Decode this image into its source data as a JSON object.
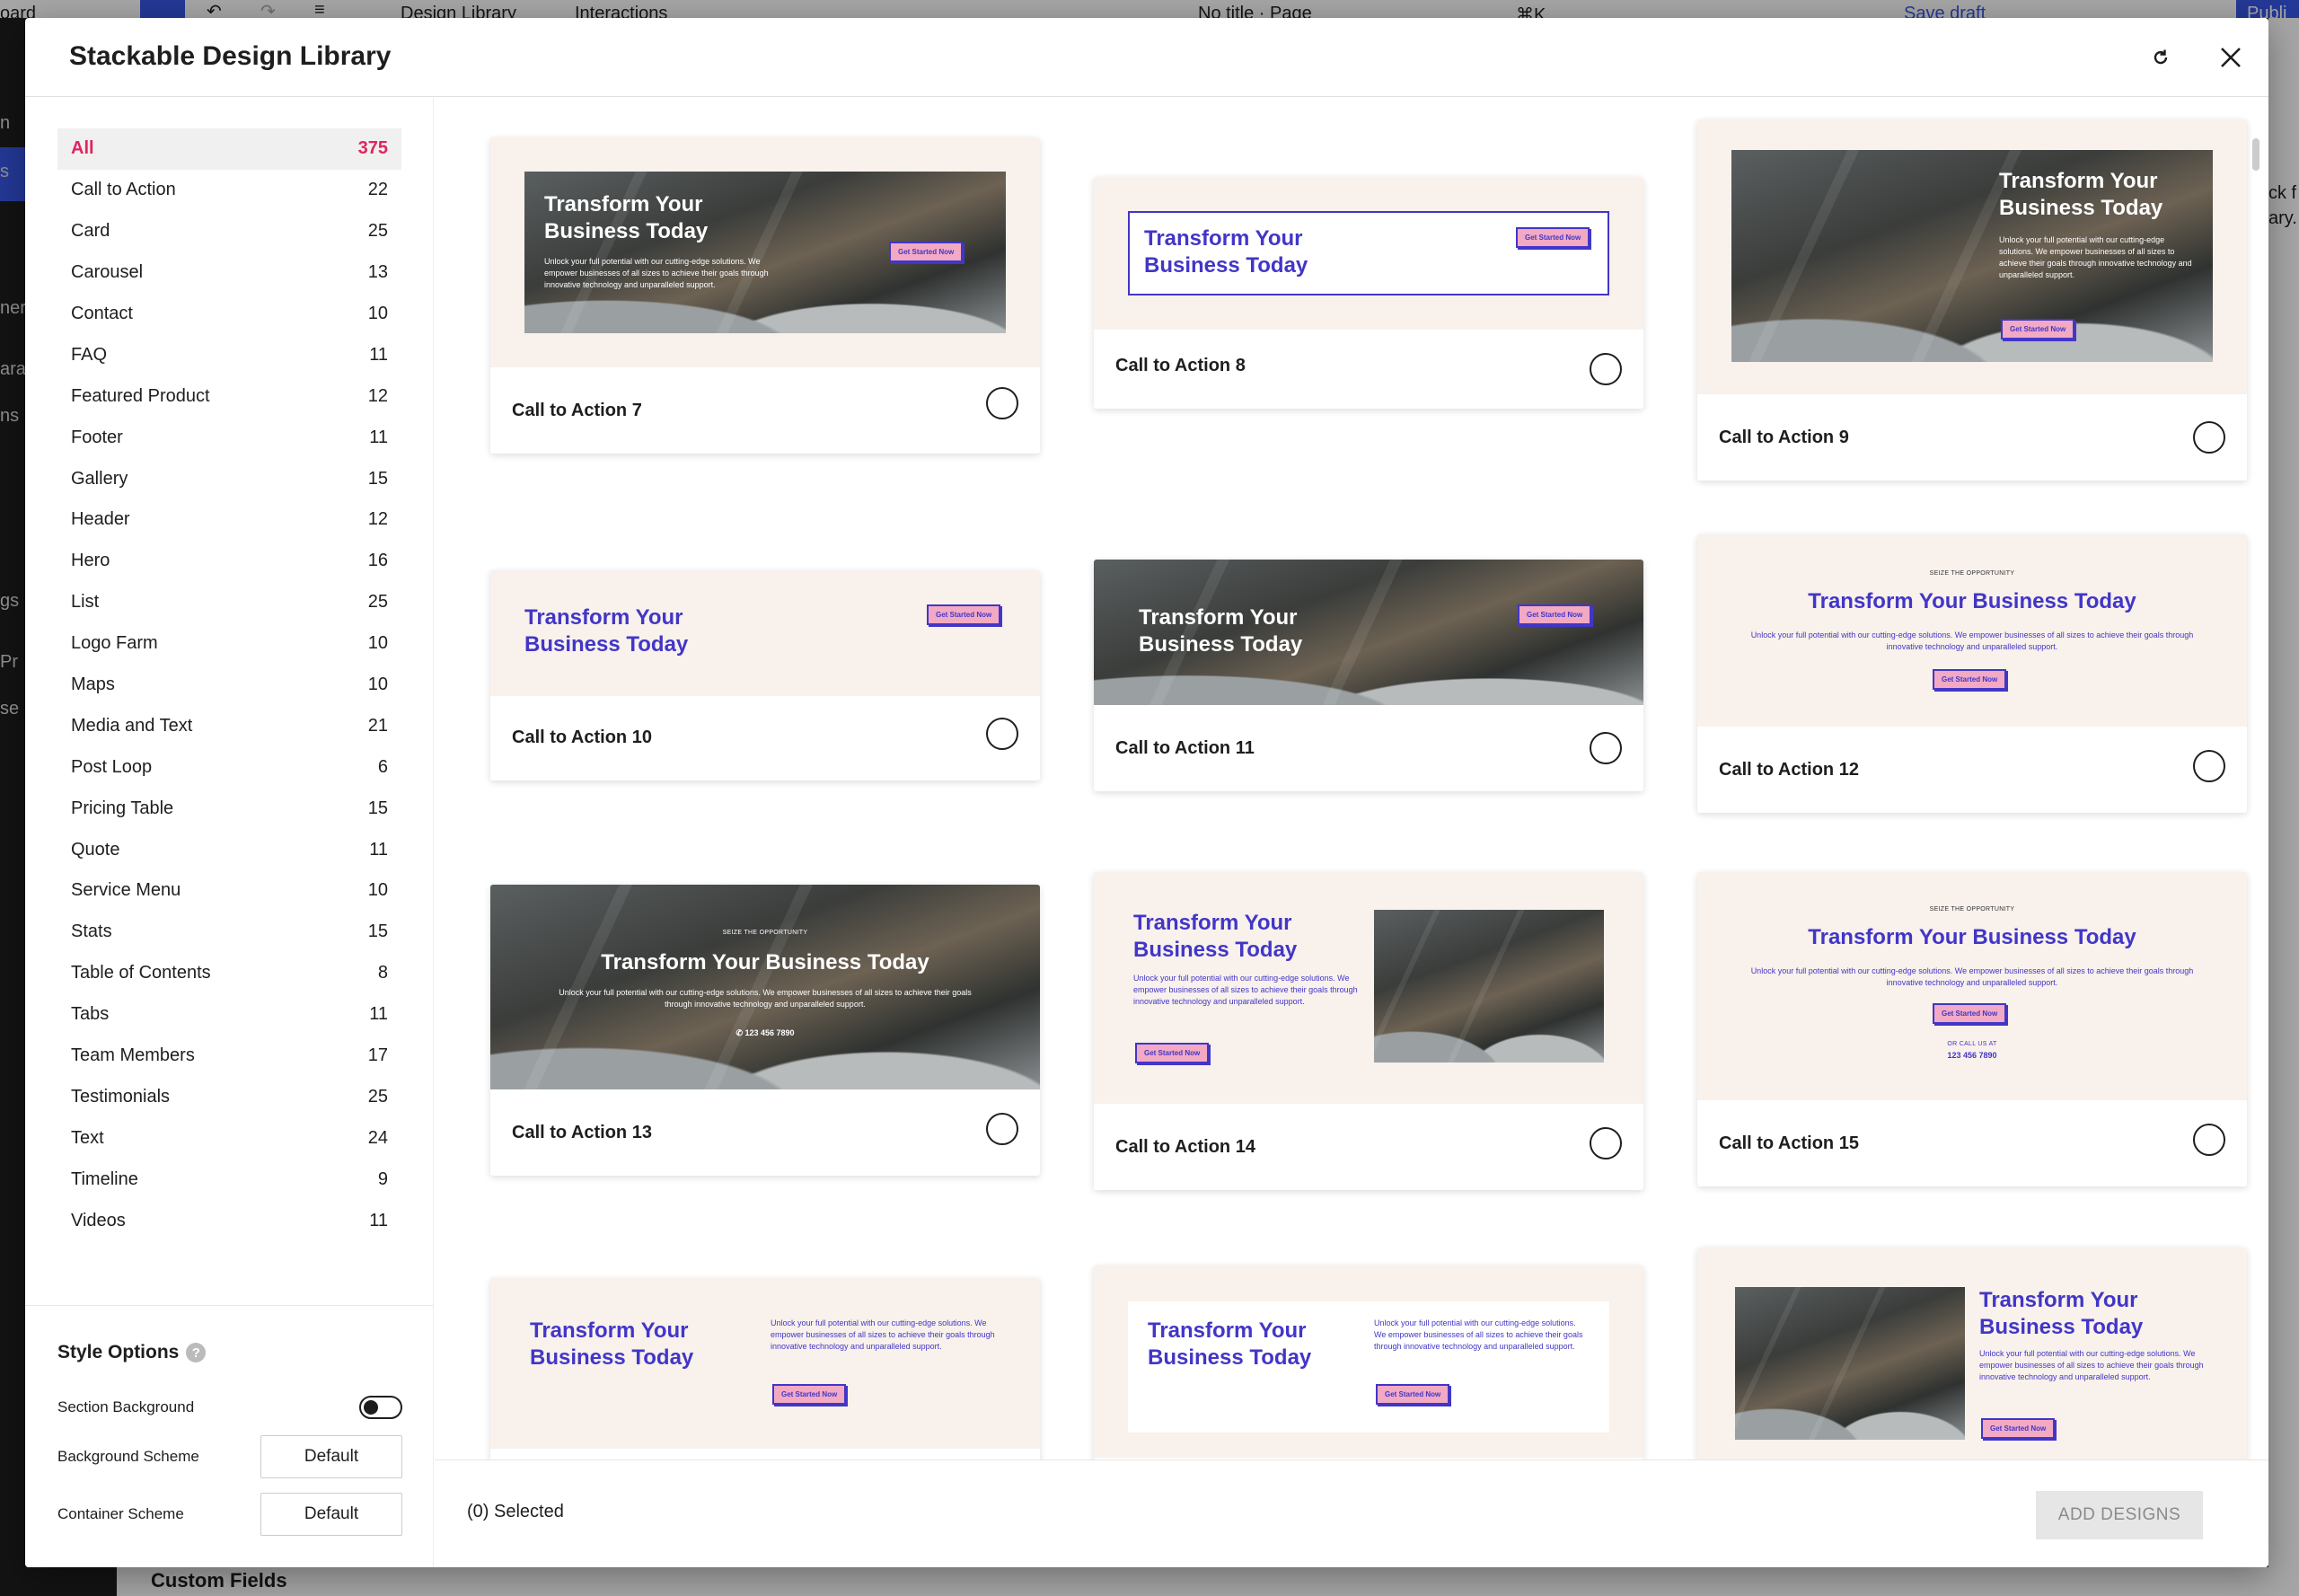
{
  "editor": {
    "left_partial": "oard",
    "tab_design_library": "Design Library",
    "tab_interactions": "Interactions",
    "doc_title": "No title · Page",
    "shortcut": "⌘K",
    "save_draft": "Save draft",
    "publish_partial": "Publi",
    "custom_fields": "Custom Fields",
    "left_fragments": [
      "n",
      "s",
      "ner",
      "ara",
      "ns",
      "gs",
      "Pr",
      "se"
    ],
    "right_fragments": [
      "ck f",
      "ary."
    ]
  },
  "modal": {
    "title": "Stackable Design Library",
    "refresh_icon": "refresh-icon",
    "close_icon": "close-icon"
  },
  "categories": [
    {
      "label": "All",
      "count": "375"
    },
    {
      "label": "Call to Action",
      "count": "22"
    },
    {
      "label": "Card",
      "count": "25"
    },
    {
      "label": "Carousel",
      "count": "13"
    },
    {
      "label": "Contact",
      "count": "10"
    },
    {
      "label": "FAQ",
      "count": "11"
    },
    {
      "label": "Featured Product",
      "count": "12"
    },
    {
      "label": "Footer",
      "count": "11"
    },
    {
      "label": "Gallery",
      "count": "15"
    },
    {
      "label": "Header",
      "count": "12"
    },
    {
      "label": "Hero",
      "count": "16"
    },
    {
      "label": "List",
      "count": "25"
    },
    {
      "label": "Logo Farm",
      "count": "10"
    },
    {
      "label": "Maps",
      "count": "10"
    },
    {
      "label": "Media and Text",
      "count": "21"
    },
    {
      "label": "Post Loop",
      "count": "6"
    },
    {
      "label": "Pricing Table",
      "count": "15"
    },
    {
      "label": "Quote",
      "count": "11"
    },
    {
      "label": "Service Menu",
      "count": "10"
    },
    {
      "label": "Stats",
      "count": "15"
    },
    {
      "label": "Table of Contents",
      "count": "8"
    },
    {
      "label": "Tabs",
      "count": "11"
    },
    {
      "label": "Team Members",
      "count": "17"
    },
    {
      "label": "Testimonials",
      "count": "25"
    },
    {
      "label": "Text",
      "count": "24"
    },
    {
      "label": "Timeline",
      "count": "9"
    },
    {
      "label": "Videos",
      "count": "11"
    }
  ],
  "style_options": {
    "title": "Style Options",
    "section_background": "Section Background",
    "background_scheme": "Background Scheme",
    "background_scheme_value": "Default",
    "container_scheme": "Container Scheme",
    "container_scheme_value": "Default"
  },
  "preview_text": {
    "heading_line1": "Transform Your",
    "heading_line2": "Business Today",
    "heading_full": "Transform Your Business Today",
    "kicker": "SEIZE THE OPPORTUNITY",
    "body": "Unlock your full potential with our cutting-edge solutions. We empower businesses of all sizes to achieve their goals through innovative technology and unparalleled support.",
    "button": "Get Started Now",
    "phone": "✆ 123 456 7890",
    "call_us": "OR CALL US AT",
    "phone_number": "123 456 7890"
  },
  "cards": [
    {
      "label": "Call to Action 7"
    },
    {
      "label": "Call to Action 8"
    },
    {
      "label": "Call to Action 9"
    },
    {
      "label": "Call to Action 10"
    },
    {
      "label": "Call to Action 11"
    },
    {
      "label": "Call to Action 12"
    },
    {
      "label": "Call to Action 13"
    },
    {
      "label": "Call to Action 14"
    },
    {
      "label": "Call to Action 15"
    }
  ],
  "footer": {
    "selected": "(0) Selected",
    "add_designs": "ADD DESIGNS"
  },
  "colors": {
    "accent_pink": "#e0245e",
    "preview_purple": "#4236c7",
    "preview_bg": "#f8f1ec"
  }
}
